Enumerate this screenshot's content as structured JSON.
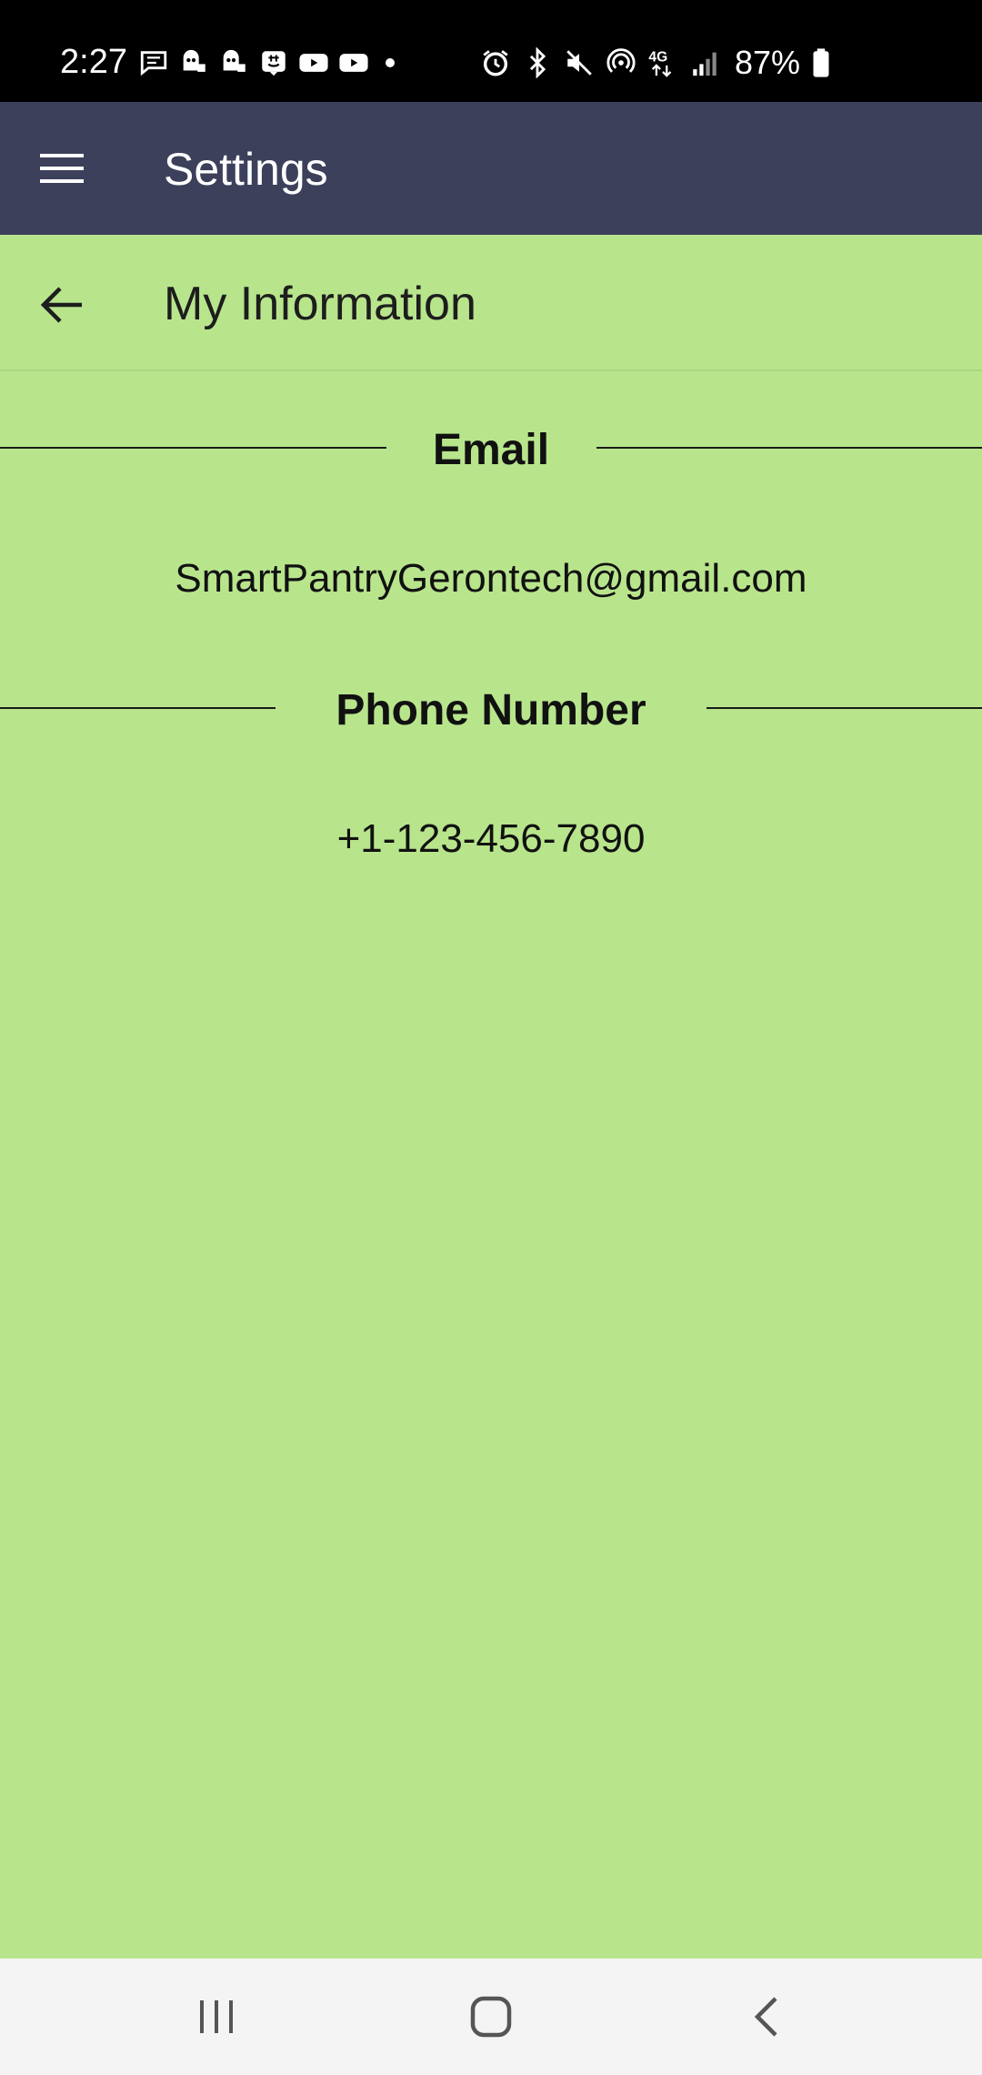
{
  "status_bar": {
    "time": "2:27",
    "battery_percent": "87%",
    "left_icons": [
      "message-icon",
      "app-icon",
      "app-icon",
      "chat-icon",
      "youtube-icon",
      "youtube-icon"
    ],
    "right_icons": [
      "alarm-icon",
      "bluetooth-icon",
      "mute-icon",
      "hotspot-icon",
      "network-4g-icon",
      "signal-icon",
      "battery-icon"
    ]
  },
  "app_bar": {
    "title": "Settings",
    "menu_icon": "hamburger-menu-icon",
    "color": "#3c405b"
  },
  "sub_header": {
    "title": "My Information",
    "back_icon": "arrow-back-icon"
  },
  "sections": {
    "email": {
      "label": "Email",
      "value": "SmartPantryGerontech@gmail.com"
    },
    "phone": {
      "label": "Phone Number",
      "value": "+1-123-456-7890"
    }
  },
  "nav_bar": {
    "recents_icon": "recents-icon",
    "home_icon": "home-icon",
    "back_icon": "nav-back-icon"
  },
  "colors": {
    "background": "#b8e58c",
    "app_bar": "#3c405b",
    "status_bar": "#000000",
    "nav_bar": "#f4f4f4"
  }
}
